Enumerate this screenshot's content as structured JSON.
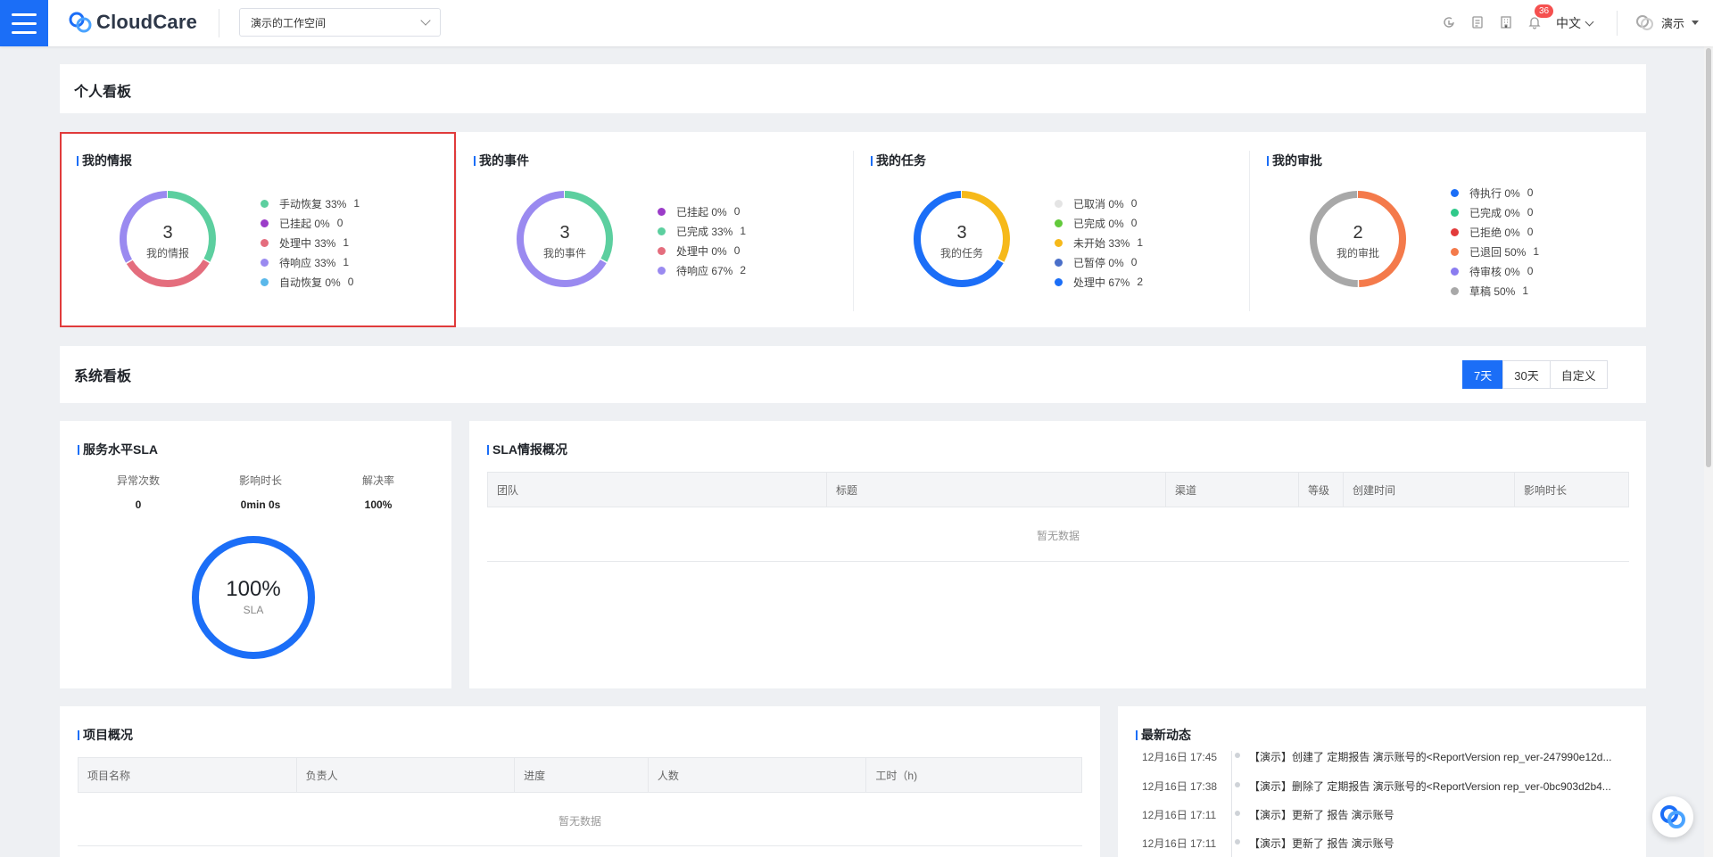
{
  "app": {
    "logo_text": "CloudCare",
    "workspace": "演示的工作空间",
    "notification_count": "36",
    "language": "中文",
    "user_name": "演示"
  },
  "personal_board": {
    "title": "个人看板",
    "cards": [
      {
        "title": "我的情报",
        "total": "3",
        "center_label": "我的情报",
        "legend": [
          {
            "label": "手动恢复 33%",
            "count": "1",
            "color": "#5ccf9f"
          },
          {
            "label": "已挂起 0%",
            "count": "0",
            "color": "#9b3cc8"
          },
          {
            "label": "处理中 33%",
            "count": "1",
            "color": "#e46d7d"
          },
          {
            "label": "待响应 33%",
            "count": "1",
            "color": "#9a8af0"
          },
          {
            "label": "自动恢复 0%",
            "count": "0",
            "color": "#5ab8ea"
          }
        ]
      },
      {
        "title": "我的事件",
        "total": "3",
        "center_label": "我的事件",
        "legend": [
          {
            "label": "已挂起 0%",
            "count": "0",
            "color": "#9b3cc8"
          },
          {
            "label": "已完成 33%",
            "count": "1",
            "color": "#5ccf9f"
          },
          {
            "label": "处理中 0%",
            "count": "0",
            "color": "#e46d7d"
          },
          {
            "label": "待响应 67%",
            "count": "2",
            "color": "#9a8af0"
          }
        ]
      },
      {
        "title": "我的任务",
        "total": "3",
        "center_label": "我的任务",
        "legend": [
          {
            "label": "已取消 0%",
            "count": "0",
            "color": "#e4e4e4"
          },
          {
            "label": "已完成 0%",
            "count": "0",
            "color": "#62c93b"
          },
          {
            "label": "未开始 33%",
            "count": "1",
            "color": "#f6b91a"
          },
          {
            "label": "已暂停 0%",
            "count": "0",
            "color": "#4a6fc9"
          },
          {
            "label": "处理中 67%",
            "count": "2",
            "color": "#1b6ef7"
          }
        ]
      },
      {
        "title": "我的审批",
        "total": "2",
        "center_label": "我的审批",
        "legend": [
          {
            "label": "待执行 0%",
            "count": "0",
            "color": "#1b6ef7"
          },
          {
            "label": "已完成 0%",
            "count": "0",
            "color": "#2fc98a"
          },
          {
            "label": "已拒绝 0%",
            "count": "0",
            "color": "#e23b3b"
          },
          {
            "label": "已退回 50%",
            "count": "1",
            "color": "#f47a4b"
          },
          {
            "label": "待审核 0%",
            "count": "0",
            "color": "#8a7cf0"
          },
          {
            "label": "草稿 50%",
            "count": "1",
            "color": "#a8a8a8"
          }
        ]
      }
    ]
  },
  "system_board": {
    "title": "系统看板",
    "ranges": [
      "7天",
      "30天",
      "自定义"
    ],
    "active_range": "7天"
  },
  "sla": {
    "title": "服务水平SLA",
    "stats": [
      {
        "label": "异常次数",
        "value": "0"
      },
      {
        "label": "影响时长",
        "value": "0min 0s"
      },
      {
        "label": "解决率",
        "value": "100%"
      }
    ],
    "ring_value": "100%",
    "ring_label": "SLA",
    "ring_fraction": 1.0
  },
  "sla_overview": {
    "title": "SLA情报概况",
    "columns": [
      "团队",
      "标题",
      "渠道",
      "等级",
      "创建时间",
      "影响时长"
    ],
    "empty_text": "暂无数据"
  },
  "projects": {
    "title": "项目概况",
    "columns": [
      "项目名称",
      "负责人",
      "进度",
      "人数",
      "工时（h)"
    ],
    "empty_text": "暂无数据"
  },
  "activity": {
    "title": "最新动态",
    "items": [
      {
        "time": "12月16日 17:45",
        "text": "【演示】创建了 定期报告 演示账号的<ReportVersion rep_ver-247990e12d..."
      },
      {
        "time": "12月16日 17:38",
        "text": "【演示】删除了 定期报告 演示账号的<ReportVersion rep_ver-0bc903d2b4..."
      },
      {
        "time": "12月16日 17:11",
        "text": "【演示】更新了 报告 演示账号"
      },
      {
        "time": "12月16日 17:11",
        "text": "【演示】更新了 报告 演示账号"
      }
    ]
  }
}
